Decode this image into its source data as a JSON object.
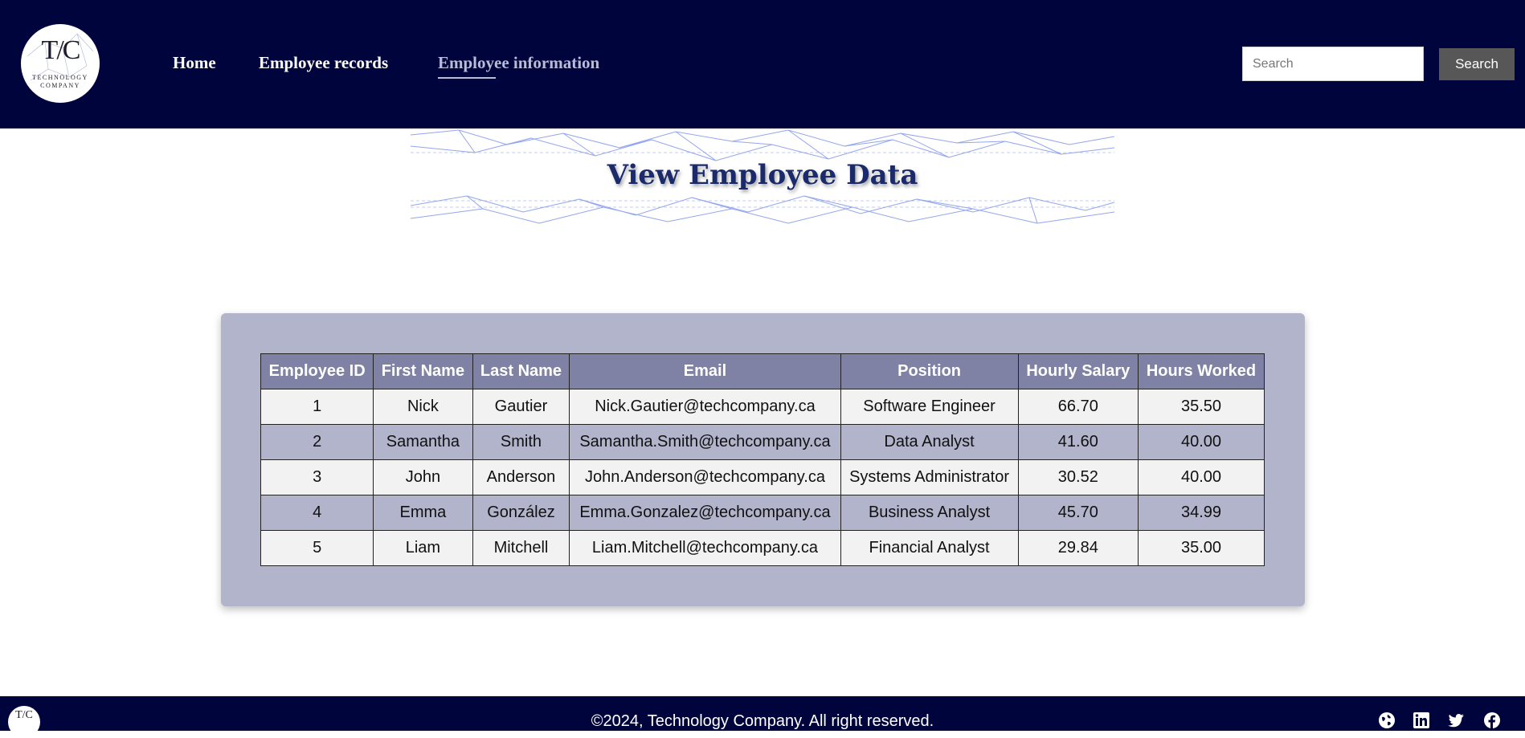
{
  "header": {
    "logo": {
      "monogram": "T/C",
      "line1": "TECHNOLOGY",
      "line2": "COMPANY"
    },
    "nav": [
      {
        "label": "Home",
        "active": false
      },
      {
        "label": "Employee records",
        "active": false
      },
      {
        "label": "Employee information",
        "active": true
      }
    ],
    "search": {
      "placeholder": "Search",
      "button_label": "Search"
    }
  },
  "banner": {
    "title": "View Employee Data"
  },
  "table": {
    "columns": [
      "Employee ID",
      "First Name",
      "Last Name",
      "Email",
      "Position",
      "Hourly Salary",
      "Hours Worked"
    ],
    "rows": [
      [
        "1",
        "Nick",
        "Gautier",
        "Nick.Gautier@techcompany.ca",
        "Software Engineer",
        "66.70",
        "35.50"
      ],
      [
        "2",
        "Samantha",
        "Smith",
        "Samantha.Smith@techcompany.ca",
        "Data Analyst",
        "41.60",
        "40.00"
      ],
      [
        "3",
        "John",
        "Anderson",
        "John.Anderson@techcompany.ca",
        "Systems Administrator",
        "30.52",
        "40.00"
      ],
      [
        "4",
        "Emma",
        "González",
        "Emma.Gonzalez@techcompany.ca",
        "Business Analyst",
        "45.70",
        "34.99"
      ],
      [
        "5",
        "Liam",
        "Mitchell",
        "Liam.Mitchell@techcompany.ca",
        "Financial Analyst",
        "29.84",
        "35.00"
      ]
    ]
  },
  "footer": {
    "copyright": "©2024, Technology Company. All right reserved.",
    "social_icons": [
      "globe-icon",
      "linkedin-icon",
      "twitter-icon",
      "facebook-icon"
    ]
  },
  "colors": {
    "header_bg": "#00043d",
    "active_nav": "#b8bcd6",
    "card_bg": "#b1b4ca",
    "table_header_bg": "#7f82a4",
    "banner_title": "#1a2a6b"
  }
}
